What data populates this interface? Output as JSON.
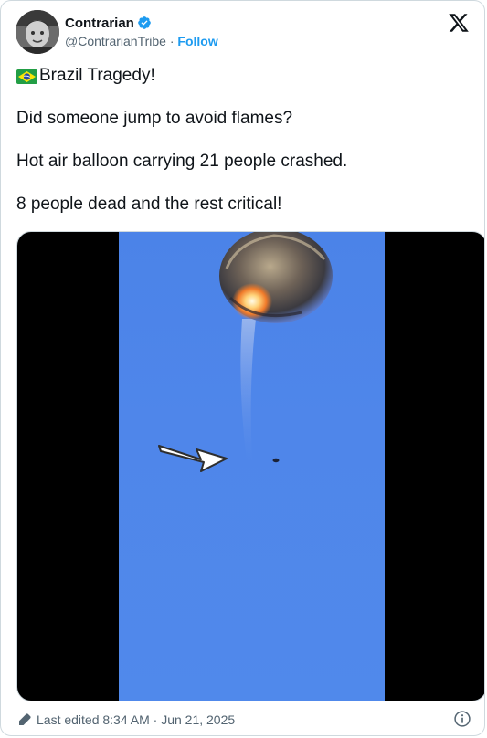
{
  "author": {
    "display_name": "Contrarian",
    "handle": "@ContrarianTribe",
    "separator": "·",
    "follow_label": "Follow"
  },
  "tweet": {
    "line1": "Brazil Tragedy!",
    "line2": "Did someone jump to avoid flames?",
    "line3": "Hot air balloon carrying 21 people crashed.",
    "line4": "8 people dead and the rest critical!"
  },
  "footer": {
    "edited_text": "Last edited 8:34 AM · Jun 21, 2025"
  },
  "colors": {
    "accent": "#1d9bf0",
    "secondary_text": "#536471",
    "sky": "#4f86ea"
  },
  "icons": [
    "verified-badge-icon",
    "x-logo-icon",
    "brazil-flag-icon",
    "edit-pencil-icon",
    "info-icon",
    "arrow-annotation-icon"
  ]
}
